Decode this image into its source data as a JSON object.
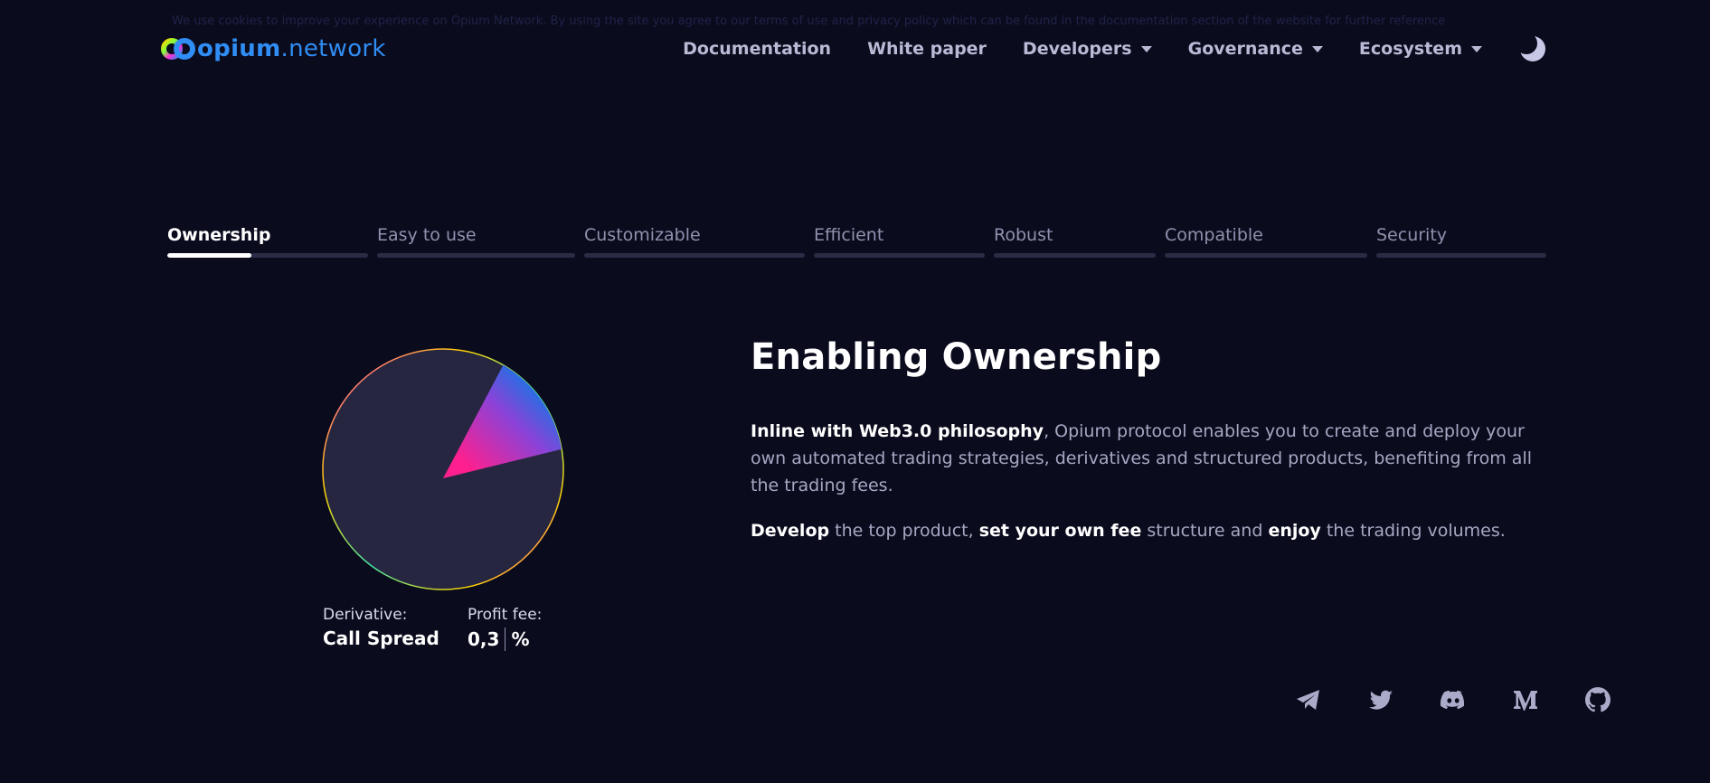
{
  "banner": {
    "text": "We use cookies to improve your experience on Opium Network. By using the site you agree to our terms of use and privacy policy which can be found in the documentation section of the website for further reference"
  },
  "logo": {
    "brand": "opium",
    "suffix": ".network"
  },
  "nav": {
    "items": [
      {
        "label": "Documentation",
        "dropdown": false
      },
      {
        "label": "White paper",
        "dropdown": false
      },
      {
        "label": "Developers",
        "dropdown": true
      },
      {
        "label": "Governance",
        "dropdown": true
      },
      {
        "label": "Ecosystem",
        "dropdown": true
      }
    ],
    "theme_icon": "moon-icon"
  },
  "tabs": [
    {
      "label": "Ownership",
      "active": true,
      "progress": 0.42
    },
    {
      "label": "Easy to use",
      "active": false,
      "progress": 0
    },
    {
      "label": "Customizable",
      "active": false,
      "progress": 0
    },
    {
      "label": "Efficient",
      "active": false,
      "progress": 0
    },
    {
      "label": "Robust",
      "active": false,
      "progress": 0
    },
    {
      "label": "Compatible",
      "active": false,
      "progress": 0
    },
    {
      "label": "Security",
      "active": false,
      "progress": 0
    }
  ],
  "pie": {
    "fee_fraction": 0.14,
    "colors": {
      "slice_start": "#ff1f8e",
      "slice_end": "#0a7ae6",
      "base": "#262641"
    }
  },
  "caption": {
    "derivative_label": "Derivative:",
    "derivative_value": "Call Spread",
    "fee_label": "Profit fee:",
    "fee_value": "0,3",
    "fee_unit": "%"
  },
  "content": {
    "headline": "Enabling Ownership",
    "p1_bold": "Inline with Web3.0 philosophy",
    "p1_rest": ", Opium protocol enables you to create and deploy your own automated trading strategies, derivatives and structured products, benefiting from all the trading fees.",
    "p2_b1": "Develop",
    "p2_t1": " the top product, ",
    "p2_b2": "set your own fee",
    "p2_t2": " structure and ",
    "p2_b3": "enjoy",
    "p2_t3": " the trading volumes."
  },
  "social": [
    "telegram-icon",
    "twitter-icon",
    "discord-icon",
    "medium-icon",
    "github-icon"
  ],
  "colors": {
    "background": "#0b0b1e",
    "nav_text": "#b9bbd6",
    "brand_blue": "#2f8df3"
  }
}
